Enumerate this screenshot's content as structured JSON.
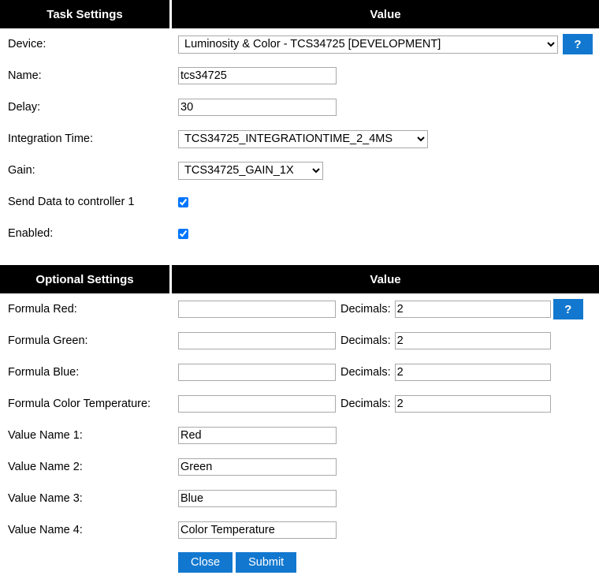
{
  "task_settings": {
    "header_left": "Task Settings",
    "header_right": "Value",
    "rows": [
      {
        "label": "Device:",
        "type": "select",
        "value": "Luminosity & Color - TCS34725 [DEVELOPMENT]"
      },
      {
        "label": "Name:",
        "type": "text",
        "value": "tcs34725"
      },
      {
        "label": "Delay:",
        "type": "text",
        "value": "30"
      },
      {
        "label": "Integration Time:",
        "type": "select",
        "value": "TCS34725_INTEGRATIONTIME_2_4MS"
      },
      {
        "label": "Gain:",
        "type": "select",
        "value": "TCS34725_GAIN_1X"
      },
      {
        "label": "Send Data to controller 1",
        "type": "checkbox",
        "checked": true
      },
      {
        "label": "Enabled:",
        "type": "checkbox",
        "checked": true
      }
    ],
    "device_help_label": "?"
  },
  "optional_settings": {
    "header_left": "Optional Settings",
    "header_right": "Value",
    "decimals_label": "Decimals:",
    "formula_help_label": "?",
    "formula_rows": [
      {
        "label": "Formula Red:",
        "formula": "",
        "decimals": "2"
      },
      {
        "label": "Formula Green:",
        "formula": "",
        "decimals": "2"
      },
      {
        "label": "Formula Blue:",
        "formula": "",
        "decimals": "2"
      },
      {
        "label": "Formula Color Temperature:",
        "formula": "",
        "decimals": "2"
      }
    ],
    "value_name_rows": [
      {
        "label": "Value Name 1:",
        "value": "Red"
      },
      {
        "label": "Value Name 2:",
        "value": "Green"
      },
      {
        "label": "Value Name 3:",
        "value": "Blue"
      },
      {
        "label": "Value Name 4:",
        "value": "Color Temperature"
      }
    ]
  },
  "footer": {
    "close_label": "Close",
    "submit_label": "Submit"
  },
  "colors": {
    "header_bg": "#000000",
    "header_text": "#ffffff",
    "accent_blue": "#1278cf",
    "input_border": "#a9a9a9",
    "page_bg": "#ffffff"
  }
}
